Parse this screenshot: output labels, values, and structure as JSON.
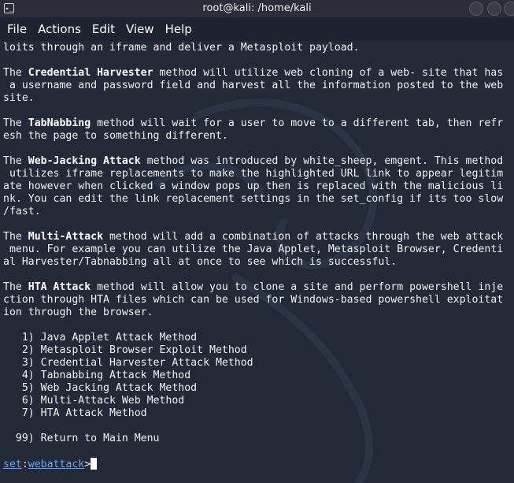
{
  "window": {
    "title": "root@kali: /home/kali",
    "terminal_icon_glyph": "▸_"
  },
  "menu": [
    "File",
    "Actions",
    "Edit",
    "View",
    "Help"
  ],
  "paragraphs": [
    {
      "lines": [
        [
          {
            "t": "loits through an iframe and deliver a Metasploit payload."
          }
        ]
      ]
    },
    {
      "lines": [
        [
          {
            "t": "The "
          },
          {
            "t": "Credential Harvester",
            "b": true
          },
          {
            "t": " method will utilize web cloning of a web- site that has"
          }
        ],
        [
          {
            "t": " a username and password field and harvest all the information posted to the web"
          }
        ],
        [
          {
            "t": "site."
          }
        ]
      ]
    },
    {
      "lines": [
        [
          {
            "t": "The "
          },
          {
            "t": "TabNabbing",
            "b": true
          },
          {
            "t": " method will wait for a user to move to a different tab, then refr"
          }
        ],
        [
          {
            "t": "esh the page to something different."
          }
        ]
      ]
    },
    {
      "lines": [
        [
          {
            "t": "The "
          },
          {
            "t": "Web-Jacking Attack",
            "b": true
          },
          {
            "t": " method was introduced by white_sheep, emgent. This method"
          }
        ],
        [
          {
            "t": " utilizes iframe replacements to make the highlighted URL link to appear legitim"
          }
        ],
        [
          {
            "t": "ate however when clicked a window pops up then is replaced with the malicious li"
          }
        ],
        [
          {
            "t": "nk. You can edit the link replacement settings in the set_config if its too slow"
          }
        ],
        [
          {
            "t": "/fast."
          }
        ]
      ]
    },
    {
      "lines": [
        [
          {
            "t": "The "
          },
          {
            "t": "Multi-Attack",
            "b": true
          },
          {
            "t": " method will add a combination of attacks through the web attack"
          }
        ],
        [
          {
            "t": " menu. For example you can utilize the Java Applet, Metasploit Browser, Credenti"
          }
        ],
        [
          {
            "t": "al Harvester/Tabnabbing all at once to see which is successful."
          }
        ]
      ]
    },
    {
      "lines": [
        [
          {
            "t": "The "
          },
          {
            "t": "HTA Attack",
            "b": true
          },
          {
            "t": " method will allow you to clone a site and perform powershell inje"
          }
        ],
        [
          {
            "t": "ction through HTA files which can be used for Windows-based powershell exploitat"
          }
        ],
        [
          {
            "t": "ion through the browser."
          }
        ]
      ]
    }
  ],
  "options": [
    "   1) Java Applet Attack Method",
    "   2) Metasploit Browser Exploit Method",
    "   3) Credential Harvester Attack Method",
    "   4) Tabnabbing Attack Method",
    "   5) Web Jacking Attack Method",
    "   6) Multi-Attack Web Method",
    "   7) HTA Attack Method"
  ],
  "return_option": "  99) Return to Main Menu",
  "prompt": {
    "prefix": "set",
    "separator": ":",
    "module": "webattack",
    "suffix": ">"
  },
  "colors": {
    "background": "#232937",
    "prompt_link": "#5fa8ff",
    "text": "#f2f2f2"
  }
}
